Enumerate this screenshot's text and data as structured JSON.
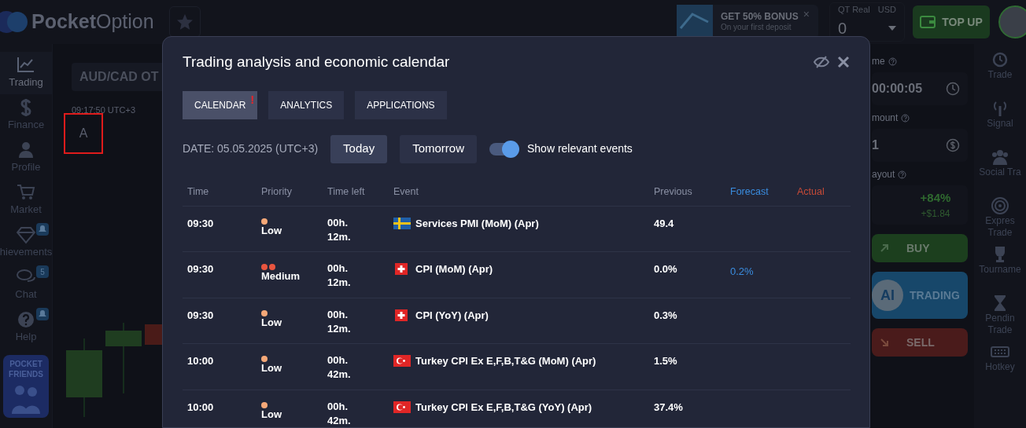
{
  "header": {
    "logo": {
      "bold": "Pocket",
      "light": "Option"
    },
    "bonus": {
      "title": "GET 50% BONUS",
      "subtitle": "On your first deposit",
      "close": "×"
    },
    "account": {
      "type": "QT Real",
      "currency": "USD",
      "balance": "0"
    },
    "top_up": "TOP UP"
  },
  "sidebar": {
    "items": [
      {
        "label": "Trading",
        "selected": true
      },
      {
        "label": "Finance",
        "selected": false
      },
      {
        "label": "Profile",
        "selected": false
      },
      {
        "label": "Market",
        "selected": false
      },
      {
        "label": "hievements",
        "selected": false,
        "badge": {
          "kind": "bell"
        }
      },
      {
        "label": "Chat",
        "selected": false,
        "badge": {
          "kind": "count",
          "text": "5"
        }
      },
      {
        "label": "Help",
        "selected": false,
        "badge": {
          "kind": "bell"
        }
      }
    ],
    "promo": {
      "line1": "POCKET",
      "line2": "FRIENDS"
    }
  },
  "chart_area": {
    "asset": "AUD/CAD OT",
    "clock": "09:17:50 UTC+3",
    "marker": "A"
  },
  "trade_panel": {
    "time_label": "me",
    "time_value": "00:00:05",
    "amount_label": "mount",
    "amount_value": "1",
    "payout_label": "ayout",
    "payout_percent": "+84%",
    "payout_amount": "+$1.84",
    "buy": "BUY",
    "ai": {
      "badge": "AI",
      "label": "TRADING"
    },
    "sell": "SELL"
  },
  "right_sidebar": {
    "items": [
      {
        "label": "Trade"
      },
      {
        "label": "Signal"
      },
      {
        "label": "Social Tra"
      },
      {
        "label": "Expres Trade"
      },
      {
        "label": "Tourname"
      },
      {
        "label": "Pendin Trade"
      },
      {
        "label": "Hotkey"
      }
    ]
  },
  "dialog": {
    "title": "Trading analysis and economic calendar",
    "tabs": [
      {
        "label": "CALENDAR",
        "selected": true,
        "alert": "!"
      },
      {
        "label": "ANALYTICS",
        "selected": false
      },
      {
        "label": "APPLICATIONS",
        "selected": false
      }
    ],
    "date": "DATE: 05.05.2025 (UTC+3)",
    "day_buttons": [
      {
        "label": "Today",
        "selected": true
      },
      {
        "label": "Tomorrow",
        "selected": false
      }
    ],
    "relevant_toggle": {
      "label": "Show relevant events",
      "on": true
    },
    "table": {
      "columns": [
        {
          "label": "Time",
          "kind": "plain"
        },
        {
          "label": "Priority",
          "kind": "plain"
        },
        {
          "label": "Time left",
          "kind": "plain"
        },
        {
          "label": "Event",
          "kind": "plain"
        },
        {
          "label": "Previous",
          "kind": "plain"
        },
        {
          "label": "Forecast",
          "kind": "forecast"
        },
        {
          "label": "Actual",
          "kind": "actual"
        }
      ],
      "rows": [
        {
          "time": "09:30",
          "priority": {
            "kind": "low",
            "label": "Low"
          },
          "time_left": "00h. 12m.",
          "event": "Services PMI (MoM) (Apr)",
          "previous": "49.4"
        },
        {
          "time": "09:30",
          "priority": {
            "kind": "medium",
            "label": "Medium"
          },
          "time_left": "00h. 12m.",
          "event": "CPI (MoM) (Apr)",
          "previous": "0.0%",
          "forecast": "0.2%"
        },
        {
          "time": "09:30",
          "priority": {
            "kind": "low",
            "label": "Low"
          },
          "time_left": "00h. 12m.",
          "event": "CPI (YoY) (Apr)",
          "previous": "0.3%"
        },
        {
          "time": "10:00",
          "priority": {
            "kind": "low",
            "label": "Low"
          },
          "time_left": "00h. 42m.",
          "event": "Turkey CPI Ex E,F,B,T&G (MoM) (Apr)",
          "previous": "1.5%"
        },
        {
          "time": "10:00",
          "priority": {
            "kind": "low",
            "label": "Low"
          },
          "time_left": "00h. 42m.",
          "event": "Turkey CPI Ex E,F,B,T&G (YoY) (Apr)",
          "previous": "37.4%"
        }
      ]
    }
  }
}
